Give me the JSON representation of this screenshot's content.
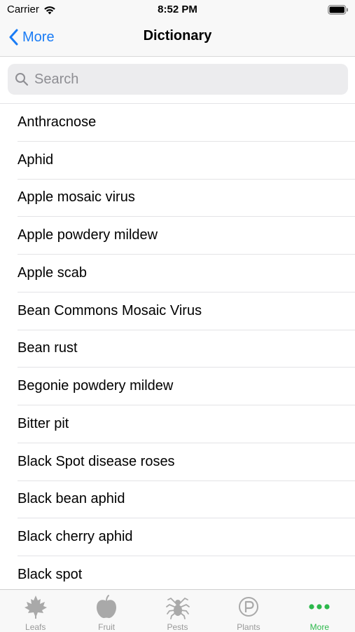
{
  "status_bar": {
    "carrier": "Carrier",
    "time": "8:52 PM"
  },
  "nav": {
    "back_label": "More",
    "title": "Dictionary"
  },
  "search": {
    "placeholder": "Search",
    "value": ""
  },
  "items": [
    "Anthracnose",
    "Aphid",
    "Apple mosaic virus",
    "Apple powdery mildew",
    "Apple scab",
    "Bean Commons Mosaic Virus",
    "Bean rust",
    "Begonie powdery mildew",
    "Bitter pit",
    "Black Spot disease roses",
    "Black bean aphid",
    "Black cherry aphid",
    "Black spot"
  ],
  "tabs": [
    {
      "label": "Leafs",
      "icon": "maple-leaf-icon"
    },
    {
      "label": "Fruit",
      "icon": "apple-icon"
    },
    {
      "label": "Pests",
      "icon": "spider-icon"
    },
    {
      "label": "Plants",
      "icon": "p-circle-icon"
    },
    {
      "label": "More",
      "icon": "more-dots-icon",
      "active": true
    }
  ],
  "colors": {
    "accent_blue": "#1a7cf5",
    "active_tab_green": "#2db84c",
    "inactive_tab_gray": "#999999",
    "bar_background": "#f8f8f8",
    "search_field_background": "#ececee"
  }
}
